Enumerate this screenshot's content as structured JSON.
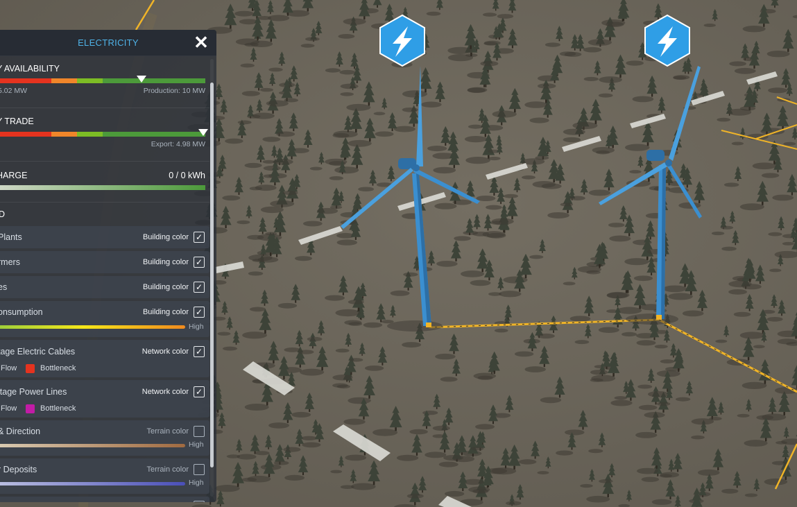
{
  "panel": {
    "title": "ELECTRICITY",
    "close_symbol": "✕"
  },
  "availability": {
    "title": "Y AVAILABILITY",
    "consumption": "5.02 MW",
    "production": "Production: 10 MW",
    "marker_fraction": 0.69
  },
  "trade": {
    "title": "Y TRADE",
    "export": "Export: 4.98 MW",
    "marker_fraction": 0.99
  },
  "charge": {
    "title": "HARGE",
    "value": "0 / 0 kWh"
  },
  "layers_header": "D",
  "layers": [
    {
      "name": "Plants",
      "color_mode": "Building color",
      "checked": true
    },
    {
      "name": "rmers",
      "color_mode": "Building color",
      "checked": true
    },
    {
      "name": "es",
      "color_mode": "Building color",
      "checked": true
    },
    {
      "name": "onsumption",
      "color_mode": "Building color",
      "checked": true,
      "scale_high": "High"
    },
    {
      "name": "tage Electric Cables",
      "color_mode": "Network color",
      "checked": true,
      "legend": [
        "Flow",
        "Bottleneck"
      ]
    },
    {
      "name": "ltage Power Lines",
      "color_mode": "Network color",
      "checked": true,
      "legend": [
        "Flow",
        "Bottleneck"
      ]
    },
    {
      "name": "& Direction",
      "color_mode": "Terrain color",
      "checked": false,
      "scale_high": "High"
    },
    {
      "name": "r Deposits",
      "color_mode": "Terrain color",
      "checked": false,
      "scale_high": "High"
    }
  ],
  "checkmark": "✓",
  "colors": {
    "title_blue": "#4fb3e8",
    "bottleneck_red": "#e5331f",
    "bottleneck_magenta": "#c21ca6",
    "turbine_blue": "#3b8fd0",
    "power_line": "#f0b428"
  },
  "map_icons": [
    "lightning-icon",
    "lightning-icon"
  ]
}
